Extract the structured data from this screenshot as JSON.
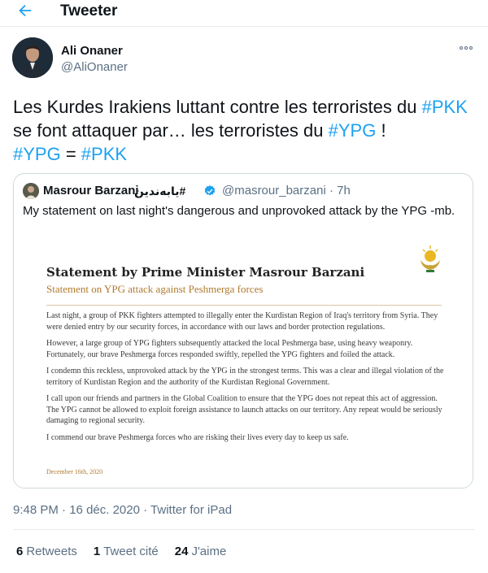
{
  "header": {
    "title": "Tweeter",
    "back_icon": "back-arrow-icon",
    "accent_color": "#1da1f2"
  },
  "tweet": {
    "author_name": "Ali Onaner",
    "author_handle": "@AliOnaner",
    "text_parts": {
      "p1": "Les Kurdes Irakiens luttant contre les terroristes du ",
      "tag_pkk_1": "#PKK",
      "p2": " se font attaquer par…  les terroristes du ",
      "tag_ypg_1": "#YPG",
      "p3": " !",
      "tag_ypg_2": "#YPG",
      "p4": " = ",
      "tag_pkk_2": "#PKK"
    },
    "more_icon": "more-options-icon"
  },
  "quoted": {
    "author_name": "Masrour Barzani",
    "author_hashtag_rtl": "#یابەندین",
    "verified_icon": "verified-badge-icon",
    "author_handle_time": "@masrour_barzani · 7h",
    "text": "My statement on last night's dangerous and unprovoked attack by the YPG -mb.",
    "image": {
      "title": "Statement by Prime Minister Masrour Barzani",
      "subtitle": "Statement on YPG attack against Peshmerga forces",
      "paragraphs": [
        "Last night, a group of PKK fighters attempted to illegally enter the Kurdistan Region of Iraq's territory from Syria. They were denied entry by our security forces, in accordance with our laws and border protection regulations.",
        "However, a large group of YPG fighters subsequently attacked the local Peshmerga base, using heavy weaponry. Fortunately, our brave Peshmerga forces responded swiftly, repelled the YPG fighters and foiled the attack.",
        "I condemn this reckless, unprovoked attack by the YPG in the strongest terms. This was a clear and illegal violation of the territory of Kurdistan Region and the authority of the Kurdistan Regional Government.",
        "I call upon our friends and partners in the Global Coalition to ensure that the YPG does not repeat this act of aggression. The YPG cannot be allowed to exploit foreign assistance to launch attacks on our territory. Any repeat would be seriously damaging to regional security.",
        "I commend our brave Peshmerga forces who are risking their lives every day to keep us safe."
      ],
      "date": "December 16th, 2020",
      "logo_icon": "kurdistan-emblem-icon"
    }
  },
  "meta": {
    "time": "9:48 PM",
    "separator": " · ",
    "date": "16 déc. 2020",
    "source": "Twitter for iPad"
  },
  "stats": {
    "retweets_count": "6",
    "retweets_label": "Retweets",
    "quotes_count": "1",
    "quotes_label": "Tweet cité",
    "likes_count": "24",
    "likes_label": "J'aime"
  }
}
